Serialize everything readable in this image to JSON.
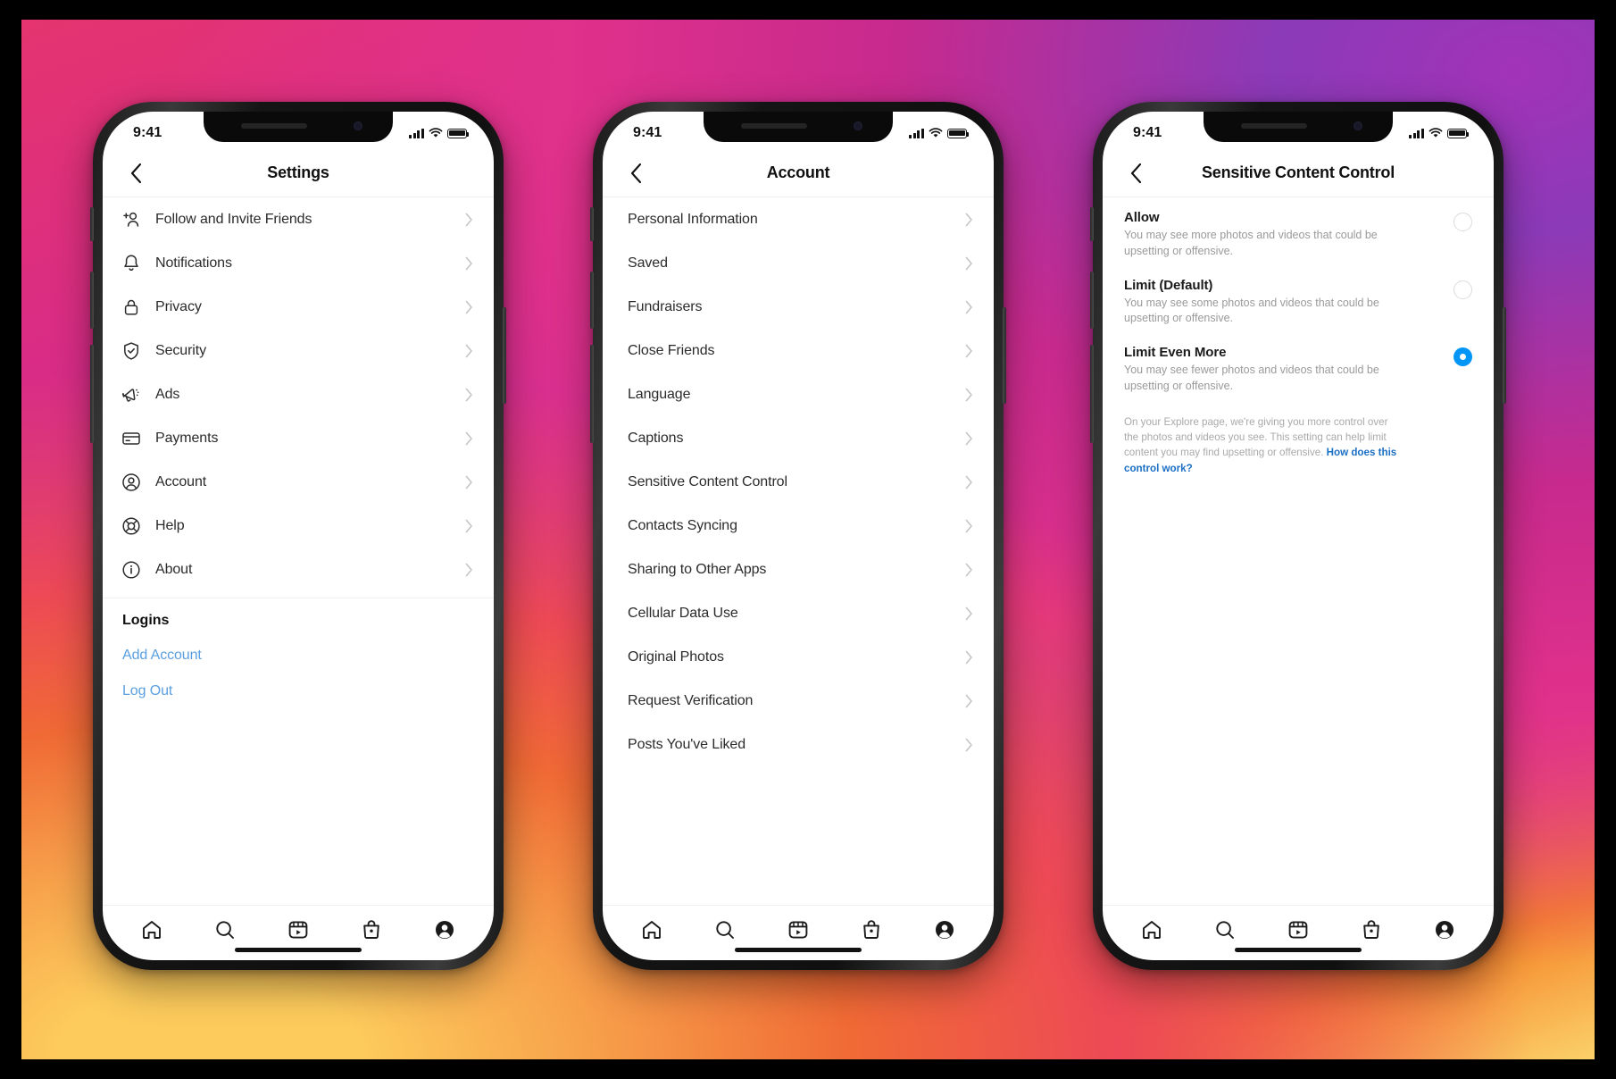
{
  "background": {
    "brand_gradient": [
      "#FBD16A",
      "#F58529",
      "#ED4956",
      "#C32AA3",
      "#8A3AB9"
    ]
  },
  "colors": {
    "link_blue": "#5A9FE0",
    "accent_blue": "#0095F6",
    "footnote_link": "#1B6FC4",
    "text": "#2b2b2b",
    "muted": "#9a9a9a"
  },
  "phones": [
    {
      "status": {
        "time": "9:41",
        "signal_icon": "cellular-bars-icon",
        "wifi_icon": "wifi-icon",
        "battery_icon": "battery-full-icon"
      },
      "nav": {
        "back_icon": "chevron-left-icon",
        "title": "Settings"
      },
      "list": [
        {
          "label": "Follow and Invite Friends",
          "icon": "person-add-icon"
        },
        {
          "label": "Notifications",
          "icon": "bell-icon"
        },
        {
          "label": "Privacy",
          "icon": "lock-icon"
        },
        {
          "label": "Security",
          "icon": "shield-check-icon"
        },
        {
          "label": "Ads",
          "icon": "megaphone-icon"
        },
        {
          "label": "Payments",
          "icon": "credit-card-icon"
        },
        {
          "label": "Account",
          "icon": "person-circle-icon"
        },
        {
          "label": "Help",
          "icon": "lifebuoy-icon"
        },
        {
          "label": "About",
          "icon": "info-circle-icon"
        }
      ],
      "section_title": "Logins",
      "links": [
        {
          "label": "Add Account"
        },
        {
          "label": "Log Out"
        }
      ]
    },
    {
      "status": {
        "time": "9:41",
        "signal_icon": "cellular-bars-icon",
        "wifi_icon": "wifi-icon",
        "battery_icon": "battery-full-icon"
      },
      "nav": {
        "back_icon": "chevron-left-icon",
        "title": "Account"
      },
      "list": [
        {
          "label": "Personal Information"
        },
        {
          "label": "Saved"
        },
        {
          "label": "Fundraisers"
        },
        {
          "label": "Close Friends"
        },
        {
          "label": "Language"
        },
        {
          "label": "Captions"
        },
        {
          "label": "Sensitive Content Control"
        },
        {
          "label": "Contacts Syncing"
        },
        {
          "label": "Sharing to Other Apps"
        },
        {
          "label": "Cellular Data Use"
        },
        {
          "label": "Original Photos"
        },
        {
          "label": "Request Verification"
        },
        {
          "label": "Posts You've Liked"
        }
      ]
    },
    {
      "status": {
        "time": "9:41",
        "signal_icon": "cellular-bars-icon",
        "wifi_icon": "wifi-icon",
        "battery_icon": "battery-full-icon"
      },
      "nav": {
        "back_icon": "chevron-left-icon",
        "title": "Sensitive Content Control"
      },
      "options": [
        {
          "title": "Allow",
          "desc": "You may see more photos and videos that could be upsetting or offensive.",
          "selected": false
        },
        {
          "title": "Limit (Default)",
          "desc": "You may see some photos and videos that could be upsetting or offensive.",
          "selected": false
        },
        {
          "title": "Limit Even More",
          "desc": "You may see fewer photos and videos that could be upsetting or offensive.",
          "selected": true
        }
      ],
      "footnote": {
        "text": "On your Explore page, we're giving you more control over the photos and videos you see. This setting can help limit content you may find upsetting or offensive. ",
        "link": "How does this control work?"
      }
    }
  ],
  "tabbar": {
    "items": [
      {
        "icon": "home-icon"
      },
      {
        "icon": "search-icon"
      },
      {
        "icon": "reels-icon"
      },
      {
        "icon": "shop-bag-icon"
      },
      {
        "icon": "profile-icon"
      }
    ]
  }
}
